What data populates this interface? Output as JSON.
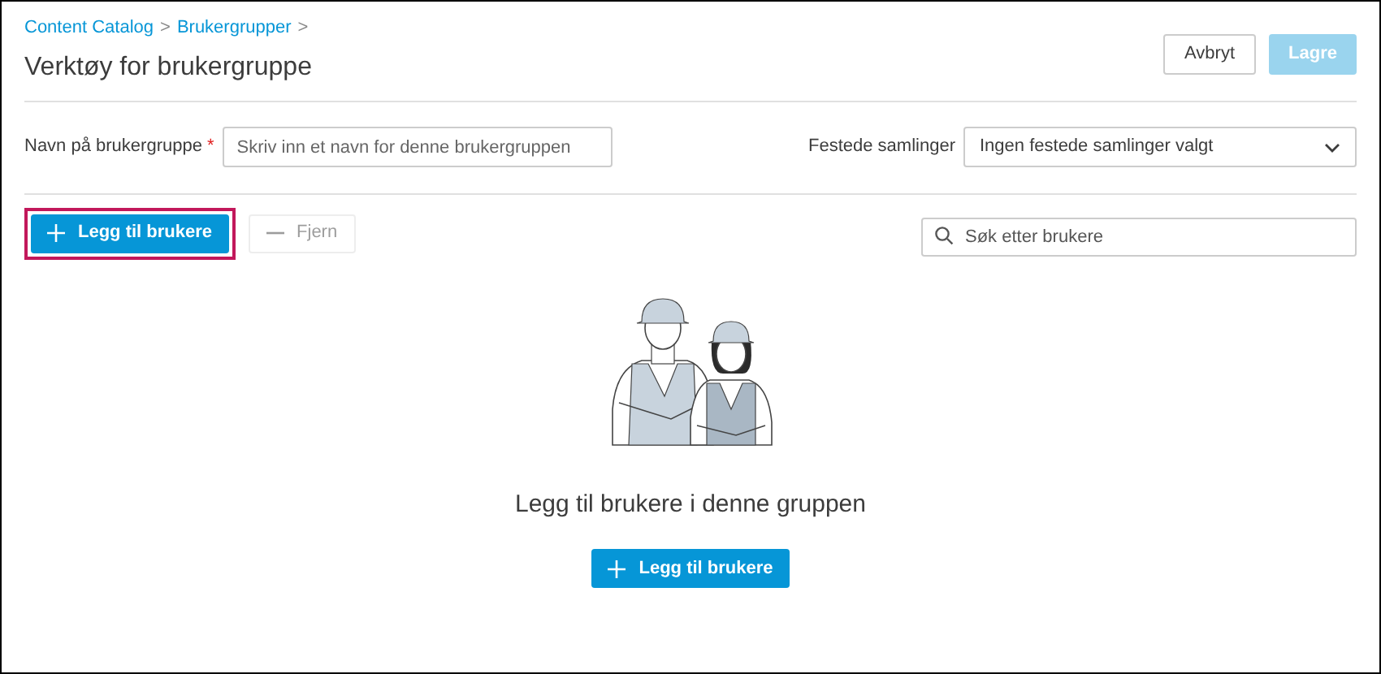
{
  "breadcrumb": [
    {
      "label": "Content Catalog",
      "separator": ">"
    },
    {
      "label": "Brukergrupper",
      "separator": ">"
    }
  ],
  "title": "Verktøy for brukergruppe",
  "header_buttons": [
    {
      "label": "Avbryt",
      "kind": "secondary",
      "disabled": false
    },
    {
      "label": "Lagre",
      "kind": "primary",
      "disabled": true
    }
  ],
  "name_field": {
    "label": "Navn på brukergruppe",
    "required_mark": "*",
    "placeholder": "Skriv inn et navn for denne brukergruppen"
  },
  "pinned_collections": {
    "label": "Festede samlinger",
    "value": "Ingen festede samlinger valgt"
  },
  "toolbar": [
    {
      "label": "Legg til brukere",
      "kind": "primary",
      "disabled": false,
      "highlighted": true
    },
    {
      "label": "Fjern",
      "kind": "remove",
      "disabled": true,
      "highlighted": false
    }
  ],
  "search": {
    "placeholder": "Søk etter brukere"
  },
  "empty_state": {
    "message": "Legg til brukere i denne gruppen",
    "button": "Legg til brukere"
  }
}
